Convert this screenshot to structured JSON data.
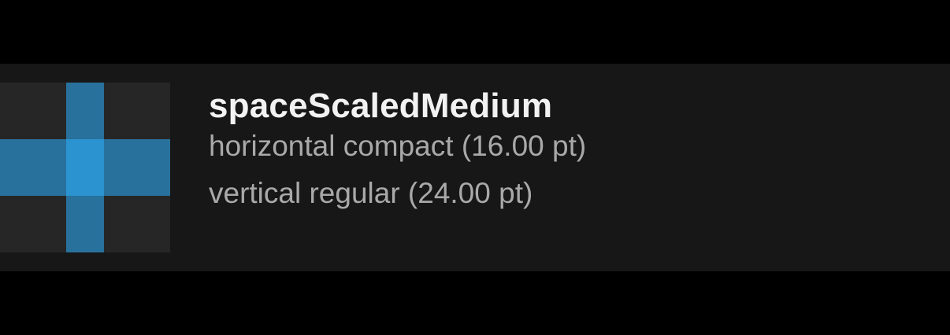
{
  "item": {
    "name": "spaceScaledMedium",
    "horizontal": "horizontal compact (16.00 pt)",
    "vertical": "vertical regular (24.00 pt)"
  },
  "colors": {
    "background": "#000000",
    "card": "#171717",
    "swatch_neutral": "#262626",
    "swatch_axis": "#28719c",
    "swatch_center": "#2a93d0",
    "title_text": "#f2f2f2",
    "detail_text": "#a9a9a9"
  }
}
